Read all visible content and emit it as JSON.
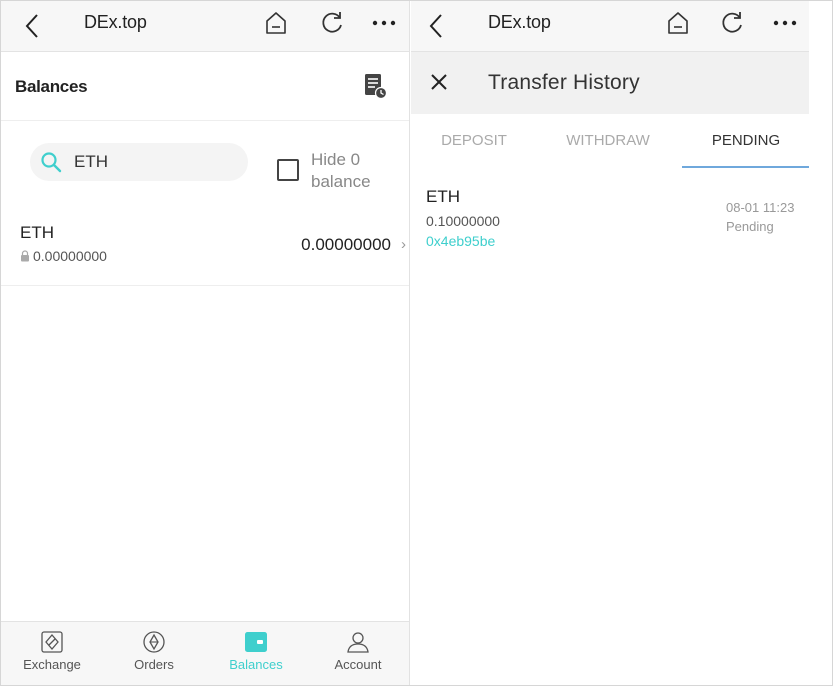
{
  "left": {
    "navbar": {
      "title": "DEx.top",
      "back_icon": "chevron-left-icon",
      "home_icon": "home-icon",
      "refresh_icon": "refresh-icon",
      "more_icon": "more-dots-icon"
    },
    "header": {
      "title": "Balances",
      "history_icon": "transfer-history-icon"
    },
    "search": {
      "value": "ETH",
      "placeholder": ""
    },
    "hide_zero": {
      "label": "Hide 0 balance",
      "checked": false
    },
    "assets": [
      {
        "symbol": "ETH",
        "locked": "0.00000000",
        "balance": "0.00000000",
        "chevron": "›"
      }
    ],
    "tabbar": [
      {
        "label": "Exchange",
        "icon": "exchange-icon",
        "active": false
      },
      {
        "label": "Orders",
        "icon": "orders-icon",
        "active": false
      },
      {
        "label": "Balances",
        "icon": "wallet-icon",
        "active": true
      },
      {
        "label": "Account",
        "icon": "user-icon",
        "active": false
      }
    ]
  },
  "right": {
    "navbar": {
      "title": "DEx.top"
    },
    "modal": {
      "title": "Transfer History"
    },
    "tabs": [
      {
        "label": "DEPOSIT",
        "active": false
      },
      {
        "label": "WITHDRAW",
        "active": false
      },
      {
        "label": "PENDING",
        "active": true
      }
    ],
    "records": [
      {
        "symbol": "ETH",
        "amount": "0.10000000",
        "tx": "0x4eb95be",
        "time": "08-01 11:23",
        "status": "Pending"
      }
    ]
  },
  "colors": {
    "accent": "#3fcfcd",
    "tab_underline": "#6fa8dc",
    "navbar_bg": "#f7f7f7"
  }
}
